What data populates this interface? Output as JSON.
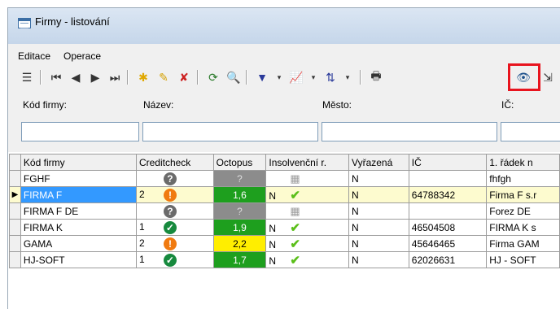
{
  "window": {
    "title": "Firmy - listování"
  },
  "menu": {
    "items": [
      "Editace",
      "Operace"
    ]
  },
  "filters": {
    "labels": [
      "Kód firmy:",
      "Název:",
      "Město:",
      "IČ:"
    ]
  },
  "table": {
    "headers": [
      "Kód firmy",
      "Creditcheck",
      "Octopus",
      "Insolvenční r.",
      "Vyřazená",
      "IČ",
      "1. řádek n"
    ],
    "rows": [
      {
        "kod": "FGHF",
        "cc_num": "",
        "cc_icon": "?",
        "oct": "?",
        "oct_color": "n",
        "ins": "",
        "vyr": "N",
        "ic": "",
        "radek": "fhfgh"
      },
      {
        "kod": "FIRMA F",
        "cc_num": "2",
        "cc_icon": "!",
        "oct": "1,6",
        "oct_color": "g",
        "ins": "N",
        "vyr": "N",
        "ic": "64788342",
        "radek": "Firma F s.r"
      },
      {
        "kod": "FIRMA F DE",
        "cc_num": "",
        "cc_icon": "?",
        "oct": "?",
        "oct_color": "n",
        "ins": "",
        "vyr": "N",
        "ic": "",
        "radek": "Forez DE"
      },
      {
        "kod": "FIRMA K",
        "cc_num": "1",
        "cc_icon": "✓",
        "oct": "1,9",
        "oct_color": "g",
        "ins": "N",
        "vyr": "N",
        "ic": "46504508",
        "radek": "FIRMA K s"
      },
      {
        "kod": "GAMA",
        "cc_num": "2",
        "cc_icon": "!",
        "oct": "2,2",
        "oct_color": "y",
        "ins": "N",
        "vyr": "N",
        "ic": "45646465",
        "radek": "Firma GAM"
      },
      {
        "kod": "HJ-SOFT",
        "cc_num": "1",
        "cc_icon": "✓",
        "oct": "1,7",
        "oct_color": "g",
        "ins": "N",
        "vyr": "N",
        "ic": "62026631",
        "radek": "HJ - SOFT"
      }
    ],
    "selected_row": 1
  },
  "icons": [
    "window-icon",
    "grid-view-icon",
    "first-record-icon",
    "prev-record-icon",
    "next-record-icon",
    "last-record-icon",
    "new-record-icon",
    "edit-record-icon",
    "delete-record-icon",
    "refresh-icon",
    "find-icon",
    "filter-icon",
    "chart-icon",
    "sort-icon",
    "print-icon",
    "view-detail-icon"
  ]
}
